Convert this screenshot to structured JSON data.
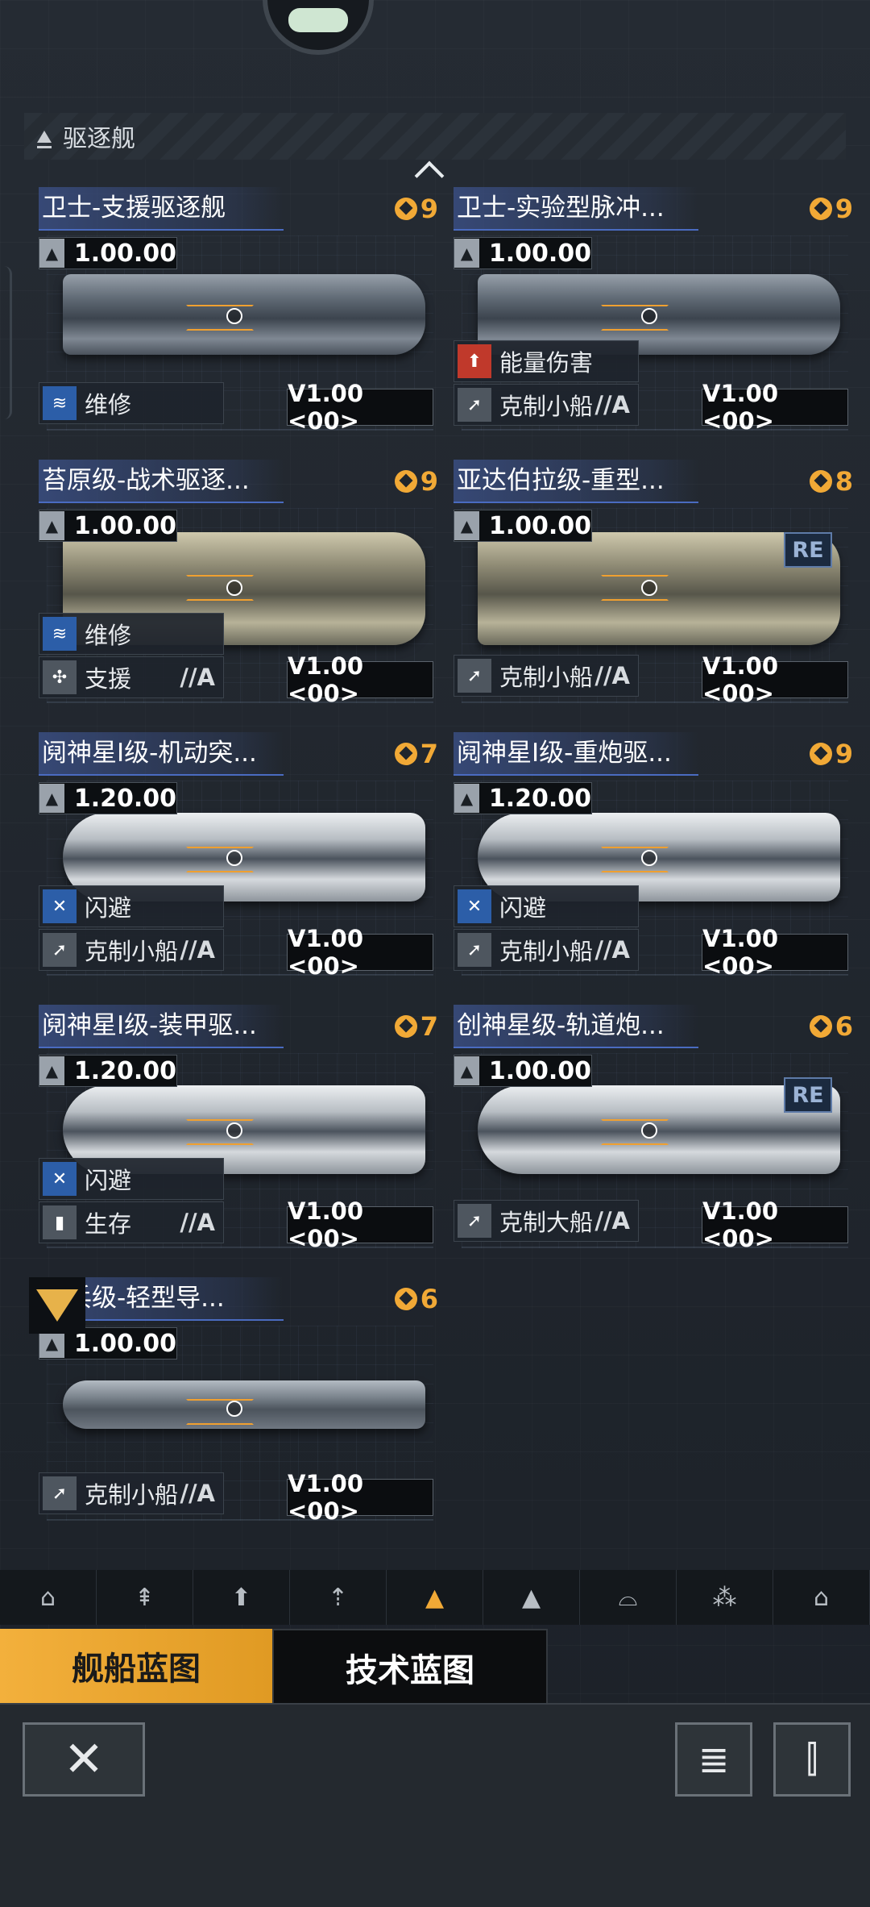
{
  "section": {
    "title": "驱逐舰"
  },
  "ships": [
    {
      "name": "卫士-支援驱逐舰",
      "rank": "9",
      "stat": "1.00.00",
      "tags": [
        {
          "label": "维修",
          "suffix": "",
          "icon": "repair-icon",
          "color": "blue"
        }
      ],
      "version": "V1.00 <00>",
      "re": ""
    },
    {
      "name": "卫士-实验型脉冲...",
      "rank": "9",
      "stat": "1.00.00",
      "tags": [
        {
          "label": "能量伤害",
          "suffix": "",
          "icon": "energy-damage-icon",
          "color": "red"
        },
        {
          "label": "克制小船",
          "suffix": "//A",
          "icon": "counter-small-ship-icon",
          "color": "grey"
        }
      ],
      "version": "V1.00 <00>",
      "re": ""
    },
    {
      "name": "苔原级-战术驱逐...",
      "rank": "9",
      "stat": "1.00.00",
      "tags": [
        {
          "label": "维修",
          "suffix": "",
          "icon": "repair-icon",
          "color": "blue"
        },
        {
          "label": "支援",
          "suffix": "//A",
          "icon": "support-icon",
          "color": "grey"
        }
      ],
      "version": "V1.00 <00>",
      "re": ""
    },
    {
      "name": "亚达伯拉级-重型...",
      "rank": "8",
      "stat": "1.00.00",
      "tags": [
        {
          "label": "克制小船",
          "suffix": "//A",
          "icon": "counter-small-ship-icon",
          "color": "grey"
        }
      ],
      "version": "V1.00 <00>",
      "re": "RE"
    },
    {
      "name": "阋神星I级-机动突...",
      "rank": "7",
      "stat": "1.20.00",
      "tags": [
        {
          "label": "闪避",
          "suffix": "",
          "icon": "evasion-icon",
          "color": "blue"
        },
        {
          "label": "克制小船",
          "suffix": "//A",
          "icon": "counter-small-ship-icon",
          "color": "grey"
        }
      ],
      "version": "V1.00 <00>",
      "re": ""
    },
    {
      "name": "阋神星I级-重炮驱...",
      "rank": "9",
      "stat": "1.20.00",
      "tags": [
        {
          "label": "闪避",
          "suffix": "",
          "icon": "evasion-icon",
          "color": "blue"
        },
        {
          "label": "克制小船",
          "suffix": "//A",
          "icon": "counter-small-ship-icon",
          "color": "grey"
        }
      ],
      "version": "V1.00 <00>",
      "re": ""
    },
    {
      "name": "阋神星I级-装甲驱...",
      "rank": "7",
      "stat": "1.20.00",
      "tags": [
        {
          "label": "闪避",
          "suffix": "",
          "icon": "evasion-icon",
          "color": "blue"
        },
        {
          "label": "生存",
          "suffix": "//A",
          "icon": "survival-icon",
          "color": "grey"
        }
      ],
      "version": "V1.00 <00>",
      "re": ""
    },
    {
      "name": "创神星级-轨道炮...",
      "rank": "6",
      "stat": "1.00.00",
      "tags": [
        {
          "label": "克制大船",
          "suffix": "//A",
          "icon": "counter-large-ship-icon",
          "color": "grey"
        }
      ],
      "version": "V1.00 <00>",
      "re": "RE"
    },
    {
      "name": "骑兵级-轻型导...",
      "rank": "6",
      "stat": "1.00.00",
      "tags": [
        {
          "label": "克制小船",
          "suffix": "//A",
          "icon": "counter-small-ship-icon",
          "color": "grey"
        }
      ],
      "version": "V1.00 <00>",
      "re": ""
    }
  ],
  "category_tabs": [
    "⌂",
    "⇞",
    "⬆",
    "⇡",
    "▲",
    "▲",
    "⌓",
    "⁂",
    "⌂"
  ],
  "main_tabs": {
    "ship_blueprint": "舰船蓝图",
    "tech_blueprint": "技术蓝图"
  },
  "actions": {
    "close": "✕",
    "notes": "≣",
    "filter": "⫿"
  }
}
